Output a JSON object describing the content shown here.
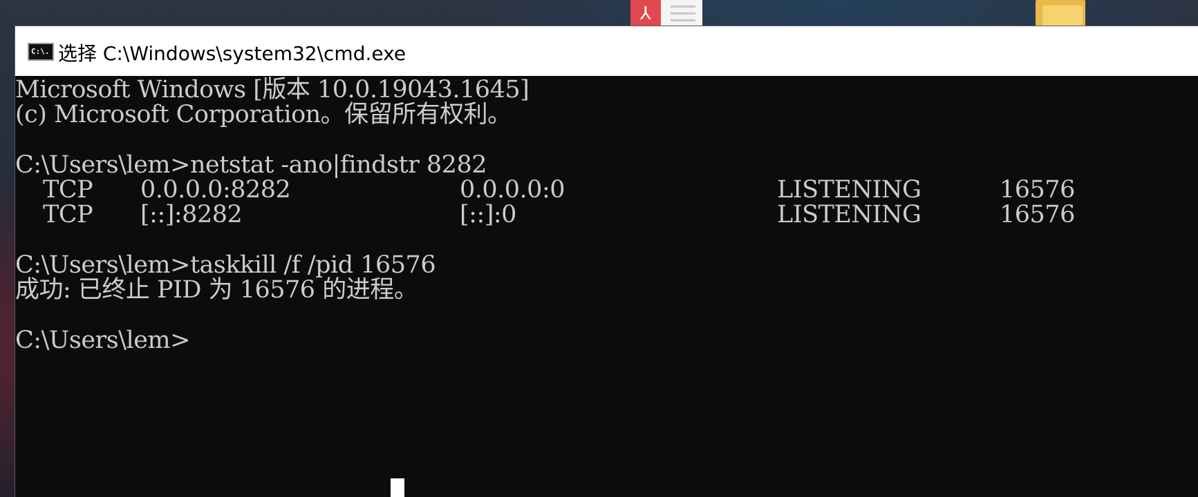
{
  "window": {
    "title": "选择 C:\\Windows\\system32\\cmd.exe",
    "icon_name": "cmd-icon",
    "icon_text": "C:\\."
  },
  "desktop": {
    "icons": [
      "pdf-file-icon",
      "folder-icon"
    ]
  },
  "console": {
    "banner_line1": "Microsoft Windows [版本 10.0.19043.1645]",
    "banner_line2": "(c) Microsoft Corporation。保留所有权利。",
    "command1": "C:\\Users\\lem>netstat -ano|findstr 8282",
    "netstat_rows": [
      {
        "proto": "TCP",
        "local": "0.0.0.0:8282",
        "foreign": "0.0.0.0:0",
        "state": "LISTENING",
        "pid": "16576"
      },
      {
        "proto": "TCP",
        "local": "[::]:8282",
        "foreign": "[::]:0",
        "state": "LISTENING",
        "pid": "16576"
      }
    ],
    "command2": "C:\\Users\\lem>taskkill /f /pid 16576",
    "result": "成功: 已终止 PID 为 16576 的进程。",
    "prompt": "C:\\Users\\lem>"
  },
  "colors": {
    "console_bg": "#0c0c0c",
    "console_text": "#cccccc",
    "title_bar_bg": "#ffffff"
  }
}
